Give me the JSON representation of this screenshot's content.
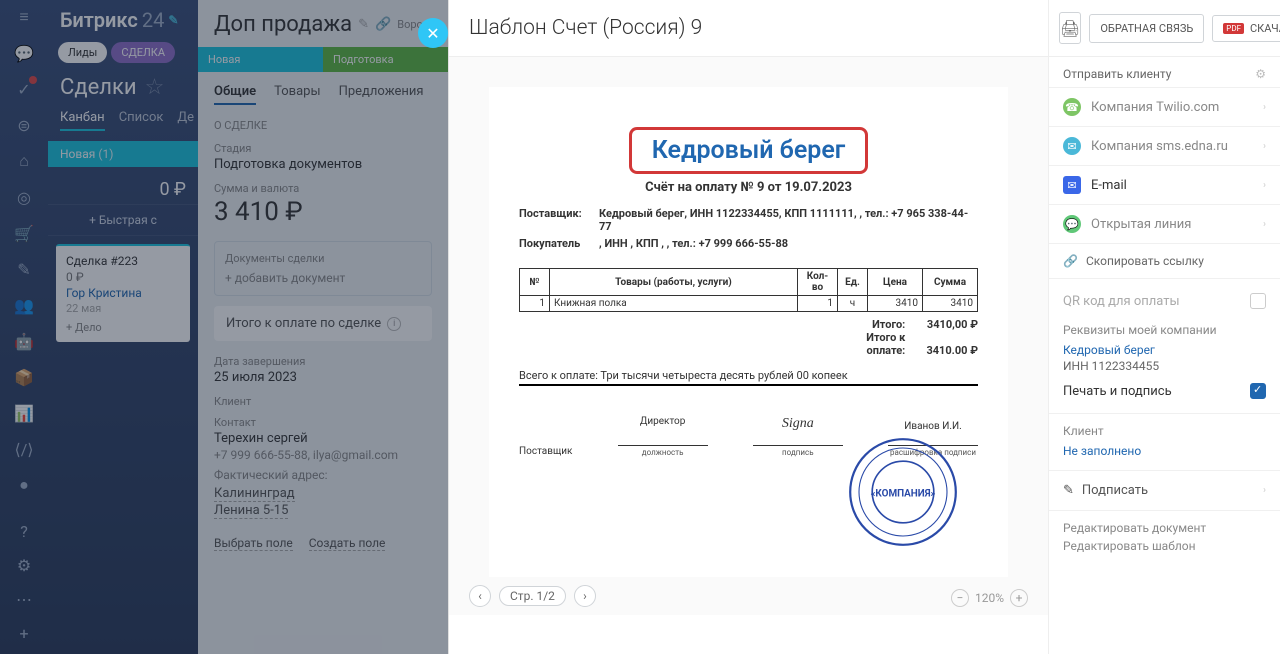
{
  "brand": {
    "name": "Битрикс",
    "suffix": "24"
  },
  "leftTabs": {
    "leads": "Лиды",
    "deal": "СДЕЛКА"
  },
  "section": {
    "title": "Сделки"
  },
  "viewTabs": {
    "kanban": "Канбан",
    "list": "Список",
    "more": "Де"
  },
  "stage": {
    "name": "Новая",
    "count": "(1)"
  },
  "stageSum": "0 ₽",
  "quickAdd": "+ Быстрая с",
  "dealCard": {
    "title": "Сделка #223",
    "amount": "0 ₽",
    "person": "Гор Кристина",
    "date": "22 мая",
    "addTask": "+ Дело"
  },
  "dealDetail": {
    "title": "Доп продажа",
    "funnel": "Воронка",
    "stages": {
      "new": "Новая",
      "prep": "Подготовка "
    },
    "tabs": {
      "general": "Общие",
      "goods": "Товары",
      "offers": "Предложения"
    },
    "aboutLabel": "О СДЕЛКЕ",
    "stageLabel": "Стадия",
    "stageValue": "Подготовка документов",
    "sumLabel": "Сумма и валюта",
    "sumValue": "3 410 ₽",
    "docsLabel": "Документы сделки",
    "addDoc": "+ добавить документ",
    "paymentLabel": "Итого к оплате по сделке",
    "endDateLabel": "Дата завершения",
    "endDateValue": "25 июля 2023",
    "clientLabel": "Клиент",
    "contactLabel": "Контакт",
    "contactName": "Терехин сергей",
    "contactPhone": "+7 999 666-55-88, ilya@gmail.com",
    "addressLabel": "Фактический адрес:",
    "city": "Калининград",
    "street": "Ленина 5-15",
    "selectField": "Выбрать поле",
    "createField": "Создать поле"
  },
  "doc": {
    "title": "Шаблон Счет (Россия) 9",
    "company": "Кедровый берег",
    "invoiceLine": "Счёт на оплату № 9 от 19.07.2023",
    "supplierLabel": "Поставщик:",
    "supplierValue": "Кедровый берег, ИНН 1122334455, КПП 1111111, , тел.: +7 965 338-44-77",
    "buyerLabel": "Покупатель",
    "buyerValue": ", ИНН , КПП , , тел.: +7 999 666-55-88",
    "table": {
      "headers": {
        "num": "№",
        "goods": "Товары (работы, услуги)",
        "qty": "Кол-во",
        "unit": "Ед.",
        "price": "Цена",
        "sum": "Сумма"
      },
      "row": {
        "num": "1",
        "goods": "Книжная полка",
        "qty": "1",
        "unit": "ч",
        "price": "3410",
        "sum": "3410"
      }
    },
    "totalLabel": "Итого:",
    "totalValue": "3410,00 ₽",
    "payLabel": "Итого к оплате:",
    "payValue": "3410.00 ₽",
    "wordsLabel": "Всего к оплате: Три тысячи четыреста десять рублей 00 копеек",
    "signSupplier": "Поставщик",
    "signDirector": "Директор",
    "signPosition": "должность",
    "signSignature": "подпись",
    "signName": "Иванов И.И.",
    "signDecipher": "расшифровка подписи",
    "stampText": "«КОМПАНИЯ»",
    "pager": "Стр. 1/2",
    "zoom": "120%"
  },
  "right": {
    "feedback": "ОБРАТНАЯ СВЯЗЬ",
    "download": "СКАЧАТЬ",
    "sendTitle": "Отправить клиенту",
    "optTwilio": "Компания Twilio.com",
    "optSms": "Компания sms.edna.ru",
    "optEmail": "E-mail",
    "optLine": "Открытая линия",
    "copyLink": "Скопировать ссылку",
    "qrLabel": "QR код для оплаты",
    "reqLabel": "Реквизиты моей компании",
    "reqCompany": "Кедровый берег",
    "reqInn": "ИНН 1122334455",
    "stampLabel": "Печать и подпись",
    "clientLabel": "Клиент",
    "clientValue": "Не заполнено",
    "signLabel": "Подписать",
    "editDoc": "Редактировать документ",
    "editTpl": "Редактировать шаблон"
  }
}
